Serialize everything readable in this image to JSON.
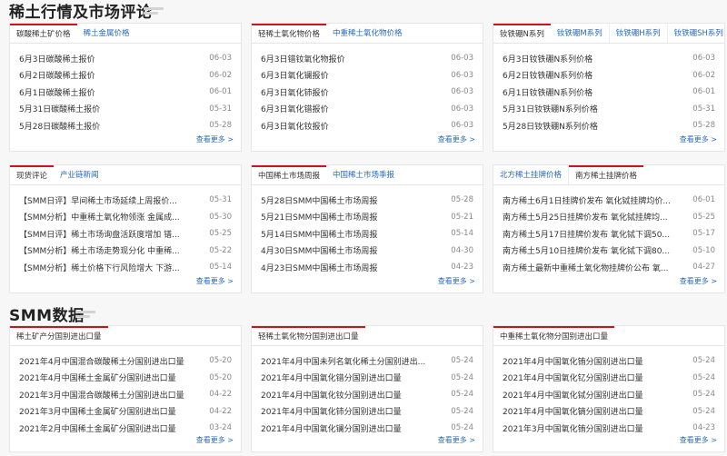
{
  "market_section": {
    "title": "稀土行情及市场评论"
  },
  "data_section": {
    "title": "SMM数据"
  },
  "more_label": "查看更多 >",
  "panels": [
    {
      "tabs": [
        "碳酸稀土矿价格",
        "稀土金属价格"
      ],
      "rows": [
        {
          "title": "6月3日碳酸稀土报价",
          "date": "06-03"
        },
        {
          "title": "6月2日碳酸稀土报价",
          "date": "06-02"
        },
        {
          "title": "6月1日碳酸稀土报价",
          "date": "06-01"
        },
        {
          "title": "5月31日碳酸稀土报价",
          "date": "05-31"
        },
        {
          "title": "5月28日碳酸稀土报价",
          "date": "05-28"
        }
      ]
    },
    {
      "tabs": [
        "轻稀土氧化物价格",
        "中重稀土氧化物价格"
      ],
      "rows": [
        {
          "title": "6月3日镨钕氧化物报价",
          "date": "06-03"
        },
        {
          "title": "6月3日氧化镧报价",
          "date": "06-03"
        },
        {
          "title": "6月3日氧化铈报价",
          "date": "06-03"
        },
        {
          "title": "6月3日氧化镨报价",
          "date": "06-03"
        },
        {
          "title": "6月3日氧化钕报价",
          "date": "06-03"
        }
      ]
    },
    {
      "tabs": [
        "钕铁硼N系列",
        "钕铁硼M系列",
        "钕铁硼H系列",
        "钕铁硼SH系列"
      ],
      "rows": [
        {
          "title": "6月3日钕铁硼N系列价格",
          "date": "06-03"
        },
        {
          "title": "6月2日钕铁硼N系列价格",
          "date": "06-02"
        },
        {
          "title": "6月1日钕铁硼N系列价格",
          "date": "06-01"
        },
        {
          "title": "5月31日钕铁硼N系列价格",
          "date": "05-31"
        },
        {
          "title": "5月28日钕铁硼N系列价格",
          "date": "05-28"
        }
      ]
    },
    {
      "tabs": [
        "现货评论",
        "产业链新闻"
      ],
      "rows": [
        {
          "title": "【SMM日评】早间稀土市场延续上周报价...",
          "date": "05-31"
        },
        {
          "title": "【SMM分析】中重稀土氧化物领涨 金属成...",
          "date": "05-30"
        },
        {
          "title": "【SMM日评】稀土市场询盘活跃度增加 镨...",
          "date": "05-25"
        },
        {
          "title": "【SMM分析】稀土市场走势现分化 中重稀...",
          "date": "05-22"
        },
        {
          "title": "【SMM分析】稀土价格下行风险增大 下游...",
          "date": "05-14"
        }
      ]
    },
    {
      "tabs": [
        "中国稀土市场周报",
        "中国稀土市场季报"
      ],
      "rows": [
        {
          "title": "5月28日SMM中国稀土市场周报",
          "date": "05-28"
        },
        {
          "title": "5月21日SMM中国稀土市场周报",
          "date": "05-21"
        },
        {
          "title": "5月14日SMM中国稀土市场周报",
          "date": "05-14"
        },
        {
          "title": "4月30日SMM中国稀土市场周报",
          "date": "04-30"
        },
        {
          "title": "4月23日SMM中国稀土市场周报",
          "date": "04-23"
        }
      ]
    },
    {
      "tabs": [
        "北方稀土挂牌价格",
        "南方稀土挂牌价格"
      ],
      "rows": [
        {
          "title": "南方稀土6月1日挂牌价发布 氧化铽挂牌均价...",
          "date": "06-01"
        },
        {
          "title": "南方稀土5月25日挂牌价发布 氧化铽挂牌均...",
          "date": "05-25"
        },
        {
          "title": "南方稀土5月17日挂牌价发布 氧化铽下调50...",
          "date": "05-17"
        },
        {
          "title": "南方稀土5月10日挂牌价发布 氧化铽下调80...",
          "date": "05-10"
        },
        {
          "title": "南方稀土最新中重稀土氧化物挂牌价公布 氧...",
          "date": "04-27"
        }
      ]
    },
    {
      "tabs": [
        "稀土矿产分国别进出口量"
      ],
      "rows": [
        {
          "title": "2021年4月中国混合碳酸稀土分国别进出口量",
          "date": "05-20"
        },
        {
          "title": "2021年4月中国稀土金属矿分国别进出口量",
          "date": "05-20"
        },
        {
          "title": "2021年3月中国混合碳酸稀土分国别进出口量",
          "date": "04-22"
        },
        {
          "title": "2021年3月中国稀土金属矿分国别进出口量",
          "date": "04-22"
        },
        {
          "title": "2021年2月中国稀土金属矿分国别进出口量",
          "date": "03-24"
        }
      ]
    },
    {
      "tabs": [
        "轻稀土氧化物分国别进出口量"
      ],
      "rows": [
        {
          "title": "2021年4月中国未列名氧化稀土分国别进出...",
          "date": "05-24"
        },
        {
          "title": "2021年4月中国氧化镨分国别进出口量",
          "date": "05-24"
        },
        {
          "title": "2021年4月中国氧化钕分国别进出口量",
          "date": "05-24"
        },
        {
          "title": "2021年4月中国氧化铈分国别进出口量",
          "date": "05-24"
        },
        {
          "title": "2021年4月中国氧化镧分国别进出口量",
          "date": "05-24"
        }
      ]
    },
    {
      "tabs": [
        "中重稀土氧化物分国别进出口量"
      ],
      "rows": [
        {
          "title": "2021年4月中国氧化铕分国别进出口量",
          "date": "05-24"
        },
        {
          "title": "2021年4月中国氧化钇分国别进出口量",
          "date": "05-24"
        },
        {
          "title": "2021年4月中国氧化铽分国别进出口量",
          "date": "05-24"
        },
        {
          "title": "2021年4月中国氧化镝分国别进出口量",
          "date": "05-24"
        },
        {
          "title": "2021年3月中国氧化铕分国别进出口量",
          "date": "04-23"
        }
      ]
    }
  ]
}
